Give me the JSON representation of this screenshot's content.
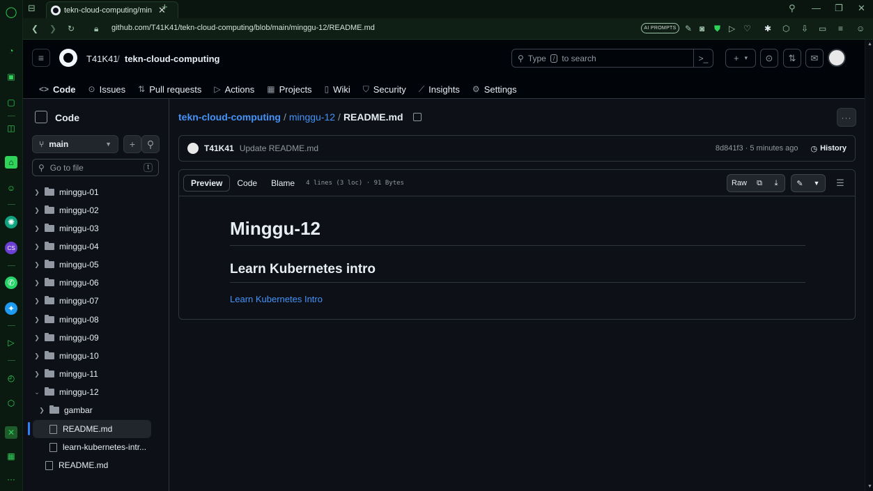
{
  "browser": {
    "tab_title": "tekn-cloud-computing/min",
    "url": "github.com/T41K41/tekn-cloud-computing/blob/main/minggu-12/README.md",
    "ai_prompts": "AI PROMPTS"
  },
  "header": {
    "owner": "T41K41",
    "slash": "/",
    "repo": "tekn-cloud-computing",
    "search_placeholder_pre": "Type",
    "search_key": "/",
    "search_placeholder_post": "to search",
    "plus": "+",
    "plus_caret": "▾"
  },
  "repo_nav": [
    {
      "label": "Code",
      "icon": "code-icon"
    },
    {
      "label": "Issues",
      "icon": "issue-icon"
    },
    {
      "label": "Pull requests",
      "icon": "pull-request-icon"
    },
    {
      "label": "Actions",
      "icon": "play-icon"
    },
    {
      "label": "Projects",
      "icon": "table-icon"
    },
    {
      "label": "Wiki",
      "icon": "book-icon"
    },
    {
      "label": "Security",
      "icon": "shield-icon"
    },
    {
      "label": "Insights",
      "icon": "graph-icon"
    },
    {
      "label": "Settings",
      "icon": "gear-icon"
    }
  ],
  "tree": {
    "title": "Code",
    "branch": "main",
    "goto_placeholder": "Go to file",
    "goto_key": "t",
    "items": [
      {
        "label": "minggu-01",
        "type": "folder",
        "expanded": false
      },
      {
        "label": "minggu-02",
        "type": "folder",
        "expanded": false
      },
      {
        "label": "minggu-03",
        "type": "folder",
        "expanded": false
      },
      {
        "label": "minggu-04",
        "type": "folder",
        "expanded": false
      },
      {
        "label": "minggu-05",
        "type": "folder",
        "expanded": false
      },
      {
        "label": "minggu-06",
        "type": "folder",
        "expanded": false
      },
      {
        "label": "minggu-07",
        "type": "folder",
        "expanded": false
      },
      {
        "label": "minggu-08",
        "type": "folder",
        "expanded": false
      },
      {
        "label": "minggu-09",
        "type": "folder",
        "expanded": false
      },
      {
        "label": "minggu-10",
        "type": "folder",
        "expanded": false
      },
      {
        "label": "minggu-11",
        "type": "folder",
        "expanded": false
      },
      {
        "label": "minggu-12",
        "type": "folder",
        "expanded": true
      },
      {
        "label": "gambar",
        "type": "folder",
        "expanded": false
      },
      {
        "label": "README.md",
        "type": "file",
        "selected": true
      },
      {
        "label": "learn-kubernetes-intr...",
        "type": "file"
      },
      {
        "label": "README.md",
        "type": "file"
      }
    ]
  },
  "main": {
    "path": {
      "repo": "tekn-cloud-computing",
      "sep1": "/",
      "folder": "minggu-12",
      "sep2": "/",
      "file": "README.md"
    },
    "more": "···",
    "commit": {
      "author": "T41K41",
      "message": "Update README.md",
      "sha_time": "8d841f3 · 5 minutes ago",
      "history": "History"
    },
    "file_tabs": [
      "Preview",
      "Code",
      "Blame"
    ],
    "file_meta": "4 lines (3 loc) · 91 Bytes",
    "raw": "Raw",
    "readme": {
      "h1": "Minggu-12",
      "h2": "Learn Kubernetes intro",
      "link": "Learn Kubernetes Intro"
    }
  }
}
